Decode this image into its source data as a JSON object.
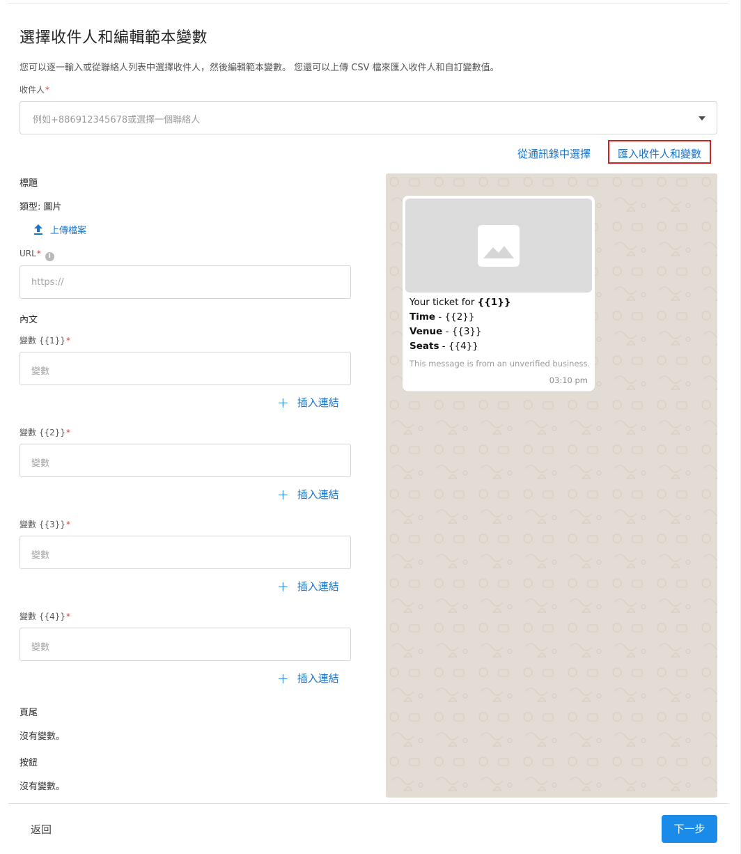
{
  "page": {
    "title": "選擇收件人和編輯範本變數",
    "description": "您可以逐一輸入或從聯絡人列表中選擇收件人，然後編輯範本變數。 您還可以上傳 CSV 檔來匯入收件人和自訂變數值。"
  },
  "recipients": {
    "label": "收件人",
    "required_mark": "*",
    "placeholder": "例如+886912345678或選擇一個聯絡人",
    "choose_from_contacts": "從通訊錄中選擇",
    "import_recipients": "匯入收件人和變數"
  },
  "header_section": {
    "heading": "標題",
    "type_text": "類型: 圖片",
    "upload_label": "上傳檔案",
    "url_label": "URL",
    "url_required_mark": "*",
    "url_placeholder": "https://"
  },
  "body_section": {
    "heading": "內文",
    "variables": [
      {
        "label": "變數 {{1}}",
        "required_mark": "*",
        "placeholder": "變數",
        "insert_link": "插入連結"
      },
      {
        "label": "變數 {{2}}",
        "required_mark": "*",
        "placeholder": "變數",
        "insert_link": "插入連結"
      },
      {
        "label": "變數 {{3}}",
        "required_mark": "*",
        "placeholder": "變數",
        "insert_link": "插入連結"
      },
      {
        "label": "變數 {{4}}",
        "required_mark": "*",
        "placeholder": "變數",
        "insert_link": "插入連結"
      }
    ]
  },
  "footer_section": {
    "heading": "頁尾",
    "text": "沒有變數。"
  },
  "buttons_section": {
    "heading": "按鈕",
    "text": "沒有變數。"
  },
  "preview": {
    "line1_text": "Your ticket for ",
    "line1_var": "{{1}}",
    "line2_bold": "Time",
    "line2_rest": " - {{2}}",
    "line3_bold": "Venue",
    "line3_rest": " - {{3}}",
    "line4_bold": "Seats",
    "line4_rest": " - {{4}}",
    "note": "This message is from an unverified business.",
    "time": "03:10 pm"
  },
  "footer_nav": {
    "back": "返回",
    "next": "下一步"
  },
  "colors": {
    "accent": "#1a73c8",
    "primary_button": "#1b8bea",
    "highlight_border": "#d32121",
    "preview_bg": "#e3dcd4"
  }
}
